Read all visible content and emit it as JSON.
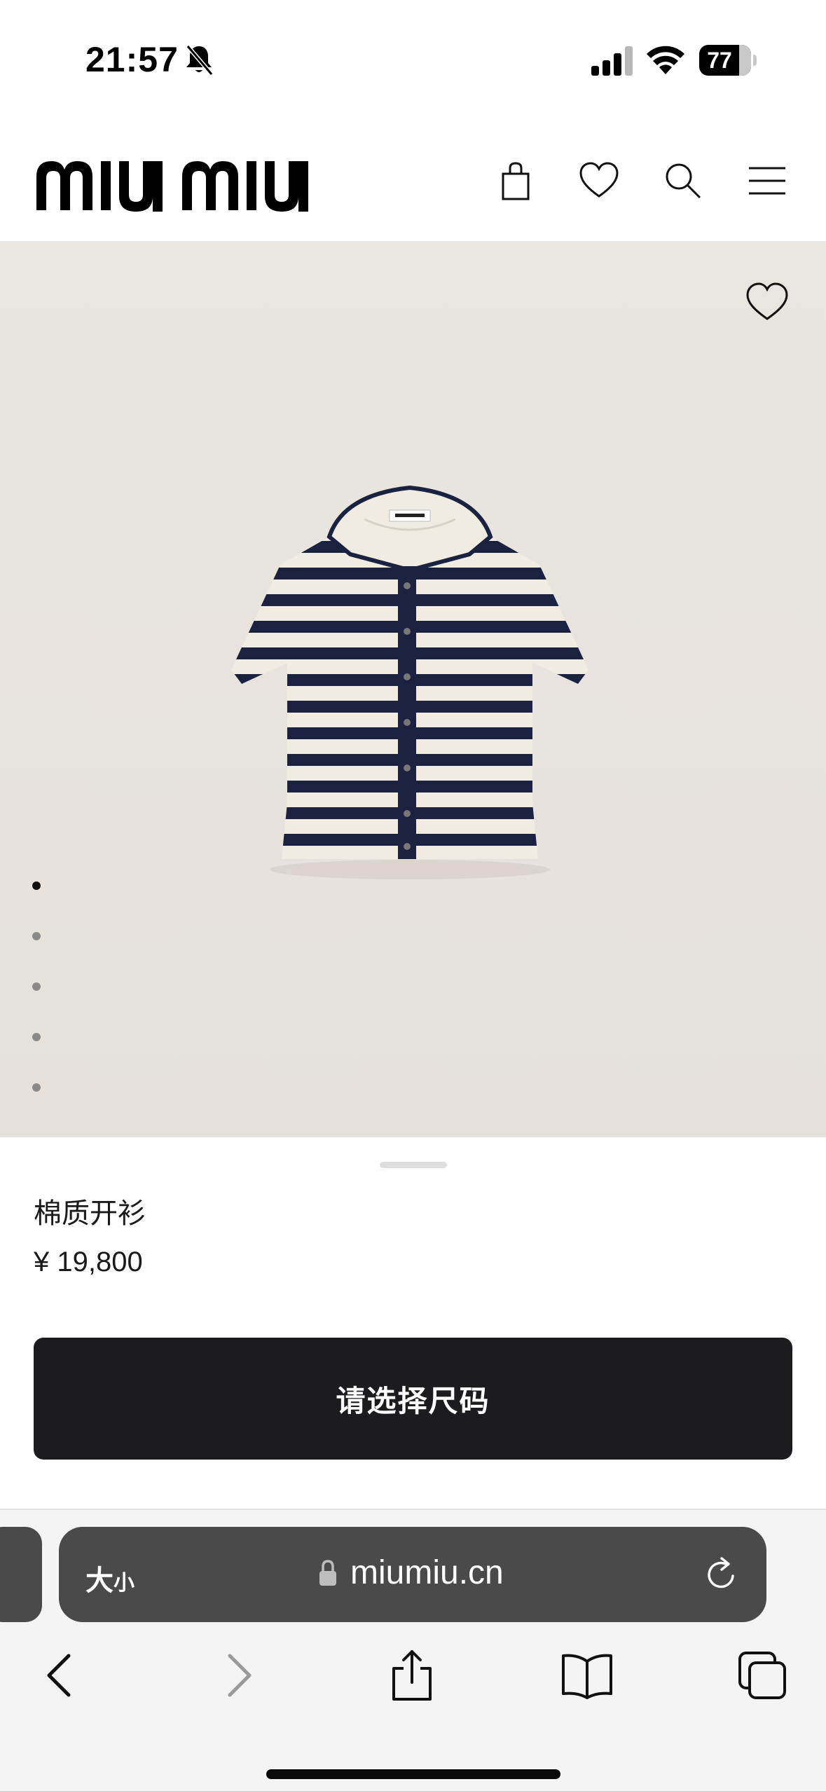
{
  "status_bar": {
    "time": "21:57",
    "battery_percent": "77",
    "battery_level": 0.77
  },
  "header": {
    "brand": "miu miu",
    "icons": [
      "shopping-bag-icon",
      "heart-icon",
      "search-icon",
      "menu-icon"
    ]
  },
  "product": {
    "name": "棉质开衫",
    "price": "¥ 19,800",
    "image_count": 5,
    "active_image": 1,
    "size_button_label": "请选择尺码"
  },
  "browser": {
    "text_size_label_big": "大",
    "text_size_label_small": "小",
    "url": "miumiu.cn"
  },
  "colors": {
    "button_bg": "#1c1c1e",
    "image_bg": "#e8e4df",
    "garment_navy": "#1b2240",
    "garment_cream": "#f1ece1",
    "address_bar_bg": "#4a4a4a"
  }
}
